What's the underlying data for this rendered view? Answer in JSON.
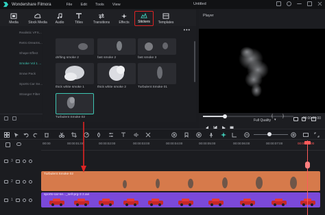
{
  "app": {
    "name": "Wondershare Filmora",
    "document_title": "Untitled",
    "menu": [
      "File",
      "Edit",
      "Tools",
      "View"
    ]
  },
  "toolbar": {
    "tabs": [
      {
        "label": "Media",
        "icon": "media-icon"
      },
      {
        "label": "Stock Media",
        "icon": "cloud-icon"
      },
      {
        "label": "Audio",
        "icon": "music-note-icon"
      },
      {
        "label": "Titles",
        "icon": "text-icon"
      },
      {
        "label": "Transitions",
        "icon": "transitions-icon"
      },
      {
        "label": "Effects",
        "icon": "effects-icon"
      },
      {
        "label": "Stickers",
        "icon": "stickers-icon",
        "active": true
      },
      {
        "label": "Templates",
        "icon": "templates-icon"
      }
    ]
  },
  "sidebar": {
    "categories": [
      {
        "label": "Realistic VFX..."
      },
      {
        "label": "Retro Dreams..."
      },
      {
        "label": "Shape Effect"
      },
      {
        "label": "Smoke Vol 1 ...",
        "active": true
      },
      {
        "label": "Snow Pack"
      },
      {
        "label": "Sports Car Se..."
      },
      {
        "label": "Stranger Filter"
      }
    ]
  },
  "grid": {
    "more_label": "•••",
    "tiles": [
      {
        "label": "drifting smoke 2"
      },
      {
        "label": "fast smoke 2"
      },
      {
        "label": "fast smoke 3"
      },
      {
        "label": "thick white smoke 1"
      },
      {
        "label": "thick white smoke 2"
      },
      {
        "label": "Turbulent Smoke 01"
      },
      {
        "label": "Turbulent Smoke 02",
        "selected": true
      }
    ]
  },
  "player": {
    "title": "Player",
    "time": "00:00:08:00",
    "progress": 0.24,
    "quality": "Full Quality",
    "bracket_in": "{",
    "bracket_out": "}"
  },
  "timeline": {
    "zoom_level": 0.45,
    "ruler_labels": [
      "00:00",
      "00:00:01:00",
      "00:00:02:00",
      "00:00:03:00",
      "00:00:04:00",
      "00:00:05:00",
      "00:00:06:00",
      "00:00:07:00",
      "00:00:08:00"
    ],
    "tracks": [
      {
        "id": "3"
      },
      {
        "id": "2"
      },
      {
        "id": "1"
      }
    ],
    "clips": {
      "sticker": {
        "label": "Turbulent Smoke 02"
      },
      "video": {
        "label": "Sports Car Se...12.avi",
        "display": "sports-car-se..._sell-prg-3 2.avi"
      }
    }
  },
  "colors": {
    "accent": "#3ec6b3",
    "highlight_red": "#e02424",
    "sticker_clip": "#d67a4b",
    "video_clip": "#7b49d9",
    "playhead": "#ff5a5a"
  }
}
